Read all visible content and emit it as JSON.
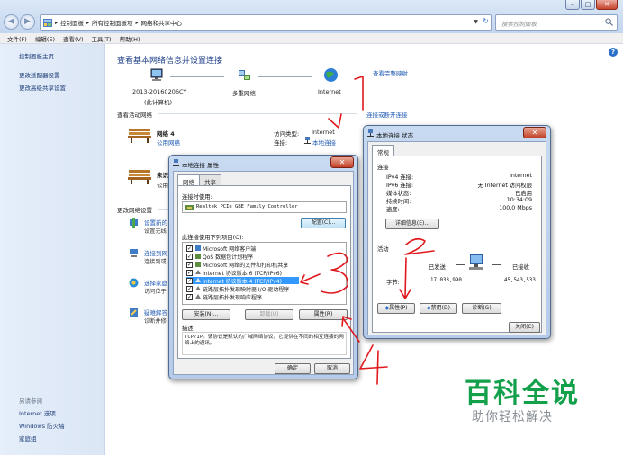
{
  "titlebar": {
    "min": "–",
    "max": "□",
    "close": "✕"
  },
  "address": {
    "crumbs": [
      "控制面板",
      "所有控制面板项",
      "网络和共享中心"
    ],
    "search_placeholder": "搜索控制面板"
  },
  "menu": [
    "文件(F)",
    "编辑(E)",
    "查看(V)",
    "工具(T)",
    "帮助(H)"
  ],
  "left": {
    "home": "控制面板主页",
    "adapter": "更改适配器设置",
    "sharing": "更改高级共享设置",
    "see_also": "另请参阅",
    "internet_options": "Internet 选项",
    "firewall": "Windows 防火墙",
    "homegroup": "家庭组"
  },
  "main": {
    "title": "查看基本网络信息并设置连接",
    "full_map": "查看完整映射",
    "computer_name": "2013-20160206CY",
    "computer_sub": "(此计算机)",
    "multi_net": "多重网络",
    "internet": "Internet",
    "active_nets": "查看活动网络",
    "connect_or_disconnect": "连接或断开连接",
    "net_name": "网络 4",
    "net_type": "公用网络",
    "access_type_label": "访问类型:",
    "access_type_value": "Internet",
    "connection_label": "连接:",
    "connection_value": "本地连接",
    "second_net_name": "未识",
    "second_net_type": "公用",
    "change_settings": "更改网络设置",
    "tasks": [
      {
        "title": "设置新的",
        "desc": "设置无线"
      },
      {
        "title": "连接到网",
        "desc": "连接到或"
      },
      {
        "title": "选择家庭",
        "desc": "访问位于"
      },
      {
        "title": "疑难解答",
        "desc": "诊断并修"
      }
    ]
  },
  "props": {
    "title": "本地连接 属性",
    "close": "✕",
    "tabs": [
      "网络",
      "共享"
    ],
    "connect_using": "连接时使用:",
    "adapter": "Realtek PCIe GBE Family Controller",
    "configure": "配置(C)...",
    "items_label": "此连接使用下列项目(O):",
    "items": [
      {
        "text": "Microsoft 网络客户端",
        "checked": true,
        "selected": false
      },
      {
        "text": "QoS 数据包计划程序",
        "checked": true,
        "selected": false
      },
      {
        "text": "Microsoft 网络的文件和打印机共享",
        "checked": true,
        "selected": false
      },
      {
        "text": "Internet 协议版本 6 (TCP/IPv6)",
        "checked": true,
        "selected": false
      },
      {
        "text": "Internet 协议版本 4 (TCP/IPv4)",
        "checked": true,
        "selected": true
      },
      {
        "text": "链路层拓扑发现映射器 I/O 驱动程序",
        "checked": true,
        "selected": false
      },
      {
        "text": "链路层拓扑发现响应程序",
        "checked": true,
        "selected": false
      }
    ],
    "install": "安装(N)...",
    "uninstall": "卸载(U)",
    "properties": "属性(R)",
    "desc_label": "描述",
    "desc_text": "TCP/IP。该协议是默认的广域网络协议，它提供在不同的相互连接的网络上的通讯。",
    "ok": "确定",
    "cancel": "取消"
  },
  "status": {
    "title": "本地连接 状态",
    "close": "✕",
    "tab": "常规",
    "connection": "连接",
    "rows": [
      {
        "label": "IPv4 连接:",
        "value": "Internet"
      },
      {
        "label": "IPv6 连接:",
        "value": "无 Internet 访问权限"
      },
      {
        "label": "媒体状态:",
        "value": "已启用"
      },
      {
        "label": "持续时间:",
        "value": "10:34:09"
      },
      {
        "label": "速度:",
        "value": "100.0 Mbps"
      }
    ],
    "details": "详细信息(E)...",
    "activity": "活动",
    "sent_label": "已发送",
    "received_label": "已接收",
    "bytes_label": "字节:",
    "bytes_sent": "17,033,990",
    "bytes_received": "45,543,533",
    "properties": "属性(P)",
    "disable": "禁用(D)",
    "diagnose": "诊断(G)",
    "close_btn": "关闭(C)"
  },
  "annotations": [
    "1",
    "2",
    "3",
    "4"
  ],
  "watermark": {
    "title": "百科全说",
    "subtitle": "助你轻松解决"
  },
  "colors": {
    "link": "#1f59b3",
    "annotation": "#e0191e",
    "brand": "#12a04a",
    "selection": "#3399ff"
  }
}
